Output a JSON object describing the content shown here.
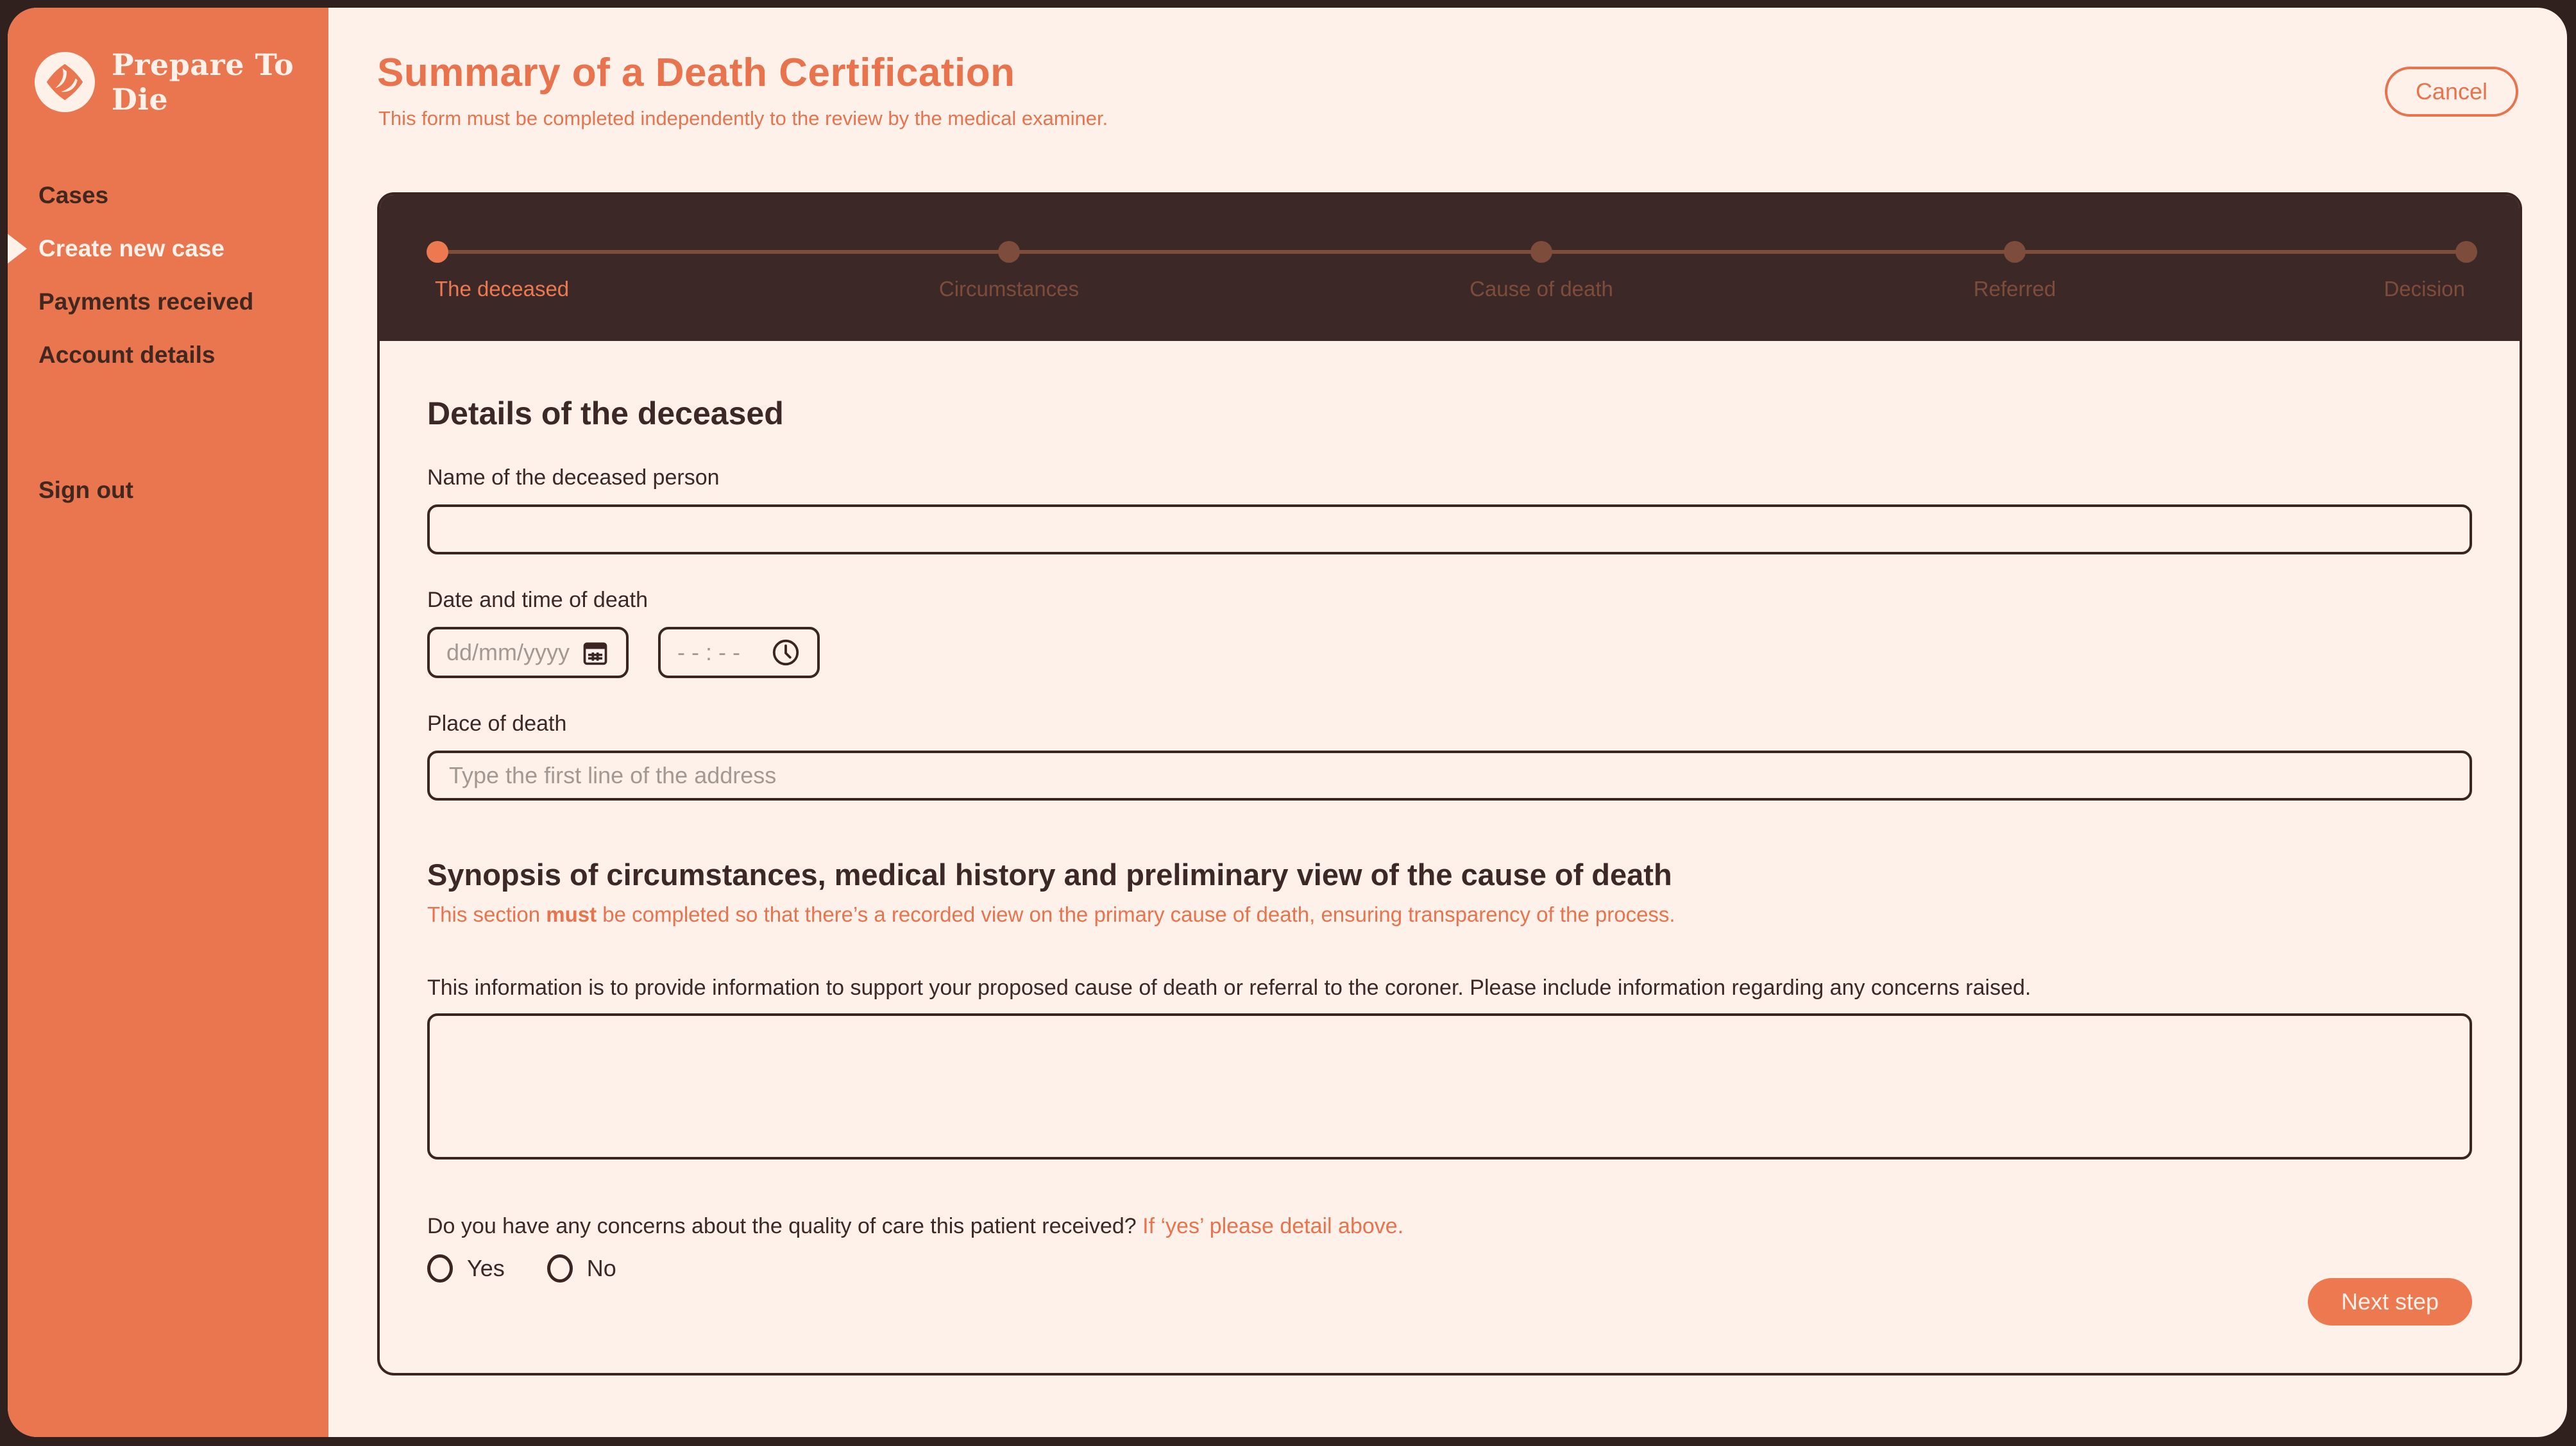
{
  "app": {
    "brand": "Prepare To Die"
  },
  "sidebar": {
    "items": [
      {
        "label": "Cases",
        "active": false
      },
      {
        "label": "Create new case",
        "active": true
      },
      {
        "label": "Payments received",
        "active": false
      },
      {
        "label": "Account details",
        "active": false
      }
    ],
    "sign_out": "Sign out"
  },
  "header": {
    "title": "Summary of a Death Certification",
    "subtitle": "This form must be completed independently to the review by the medical examiner.",
    "cancel_label": "Cancel"
  },
  "stepper": {
    "steps": [
      {
        "label": "The deceased",
        "active": true
      },
      {
        "label": "Circumstances",
        "active": false
      },
      {
        "label": "Cause of death",
        "active": false
      },
      {
        "label": "Referred",
        "active": false
      },
      {
        "label": "Decision",
        "active": false
      }
    ]
  },
  "form": {
    "details_heading": "Details of the deceased",
    "name": {
      "label": "Name of the deceased person",
      "value": ""
    },
    "datetime": {
      "label": "Date and time of death",
      "date_placeholder": "dd/mm/yyyy",
      "time_placeholder": "- - : - -"
    },
    "place": {
      "label": "Place of death",
      "placeholder": "Type the first line of the address",
      "value": ""
    },
    "synopsis_heading": "Synopsis of circumstances, medical history and preliminary view of the cause of death",
    "synopsis_note_before": "This section ",
    "synopsis_note_bold": "must",
    "synopsis_note_after": " be completed so that there’s a recorded view on the primary cause of death, ensuring transparency of the process.",
    "info_text": "This information is to provide information to support your proposed cause of death or referral to the coroner. Please include information regarding any concerns raised.",
    "synopsis_value": "",
    "concerns": {
      "question": "Do you have any concerns about the quality of care this patient received? ",
      "hint": "If ‘yes’ please detail above.",
      "options": [
        "Yes",
        "No"
      ]
    },
    "next_label": "Next step"
  },
  "icons": {
    "logo": "brand-mark-icon",
    "calendar": "calendar-icon",
    "clock": "clock-icon"
  },
  "colors": {
    "accent_orange": "#E8734D",
    "sidebar_orange": "#E9764F",
    "dark_brown": "#3B2827",
    "cream": "#FDF1EA",
    "muted_step": "#7E4C3B",
    "placeholder_gray": "#A39993"
  }
}
